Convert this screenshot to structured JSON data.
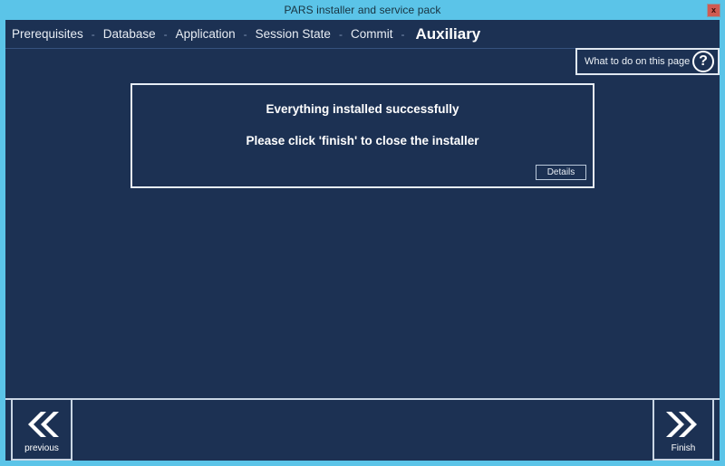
{
  "window": {
    "title": "PARS installer and service pack",
    "close_label": "x",
    "close_icon": "close-icon",
    "frame_color": "#5bc4e8",
    "body_color": "#1c3153"
  },
  "breadcrumb": {
    "separator": "-",
    "items": [
      {
        "label": "Prerequisites",
        "active": false
      },
      {
        "label": "Database",
        "active": false
      },
      {
        "label": "Application",
        "active": false
      },
      {
        "label": "Session State",
        "active": false
      },
      {
        "label": "Commit",
        "active": false
      },
      {
        "label": "Auxiliary",
        "active": true
      }
    ]
  },
  "help": {
    "label": "What to do on this page",
    "icon": "question-mark-icon",
    "glyph": "?"
  },
  "message_panel": {
    "line1": "Everything installed successfully",
    "line2": "Please click 'finish' to close the installer",
    "details_label": "Details"
  },
  "footer": {
    "previous_label": "previous",
    "previous_icon": "double-chevron-left-icon",
    "finish_label": "Finish",
    "finish_icon": "double-chevron-right-icon"
  }
}
